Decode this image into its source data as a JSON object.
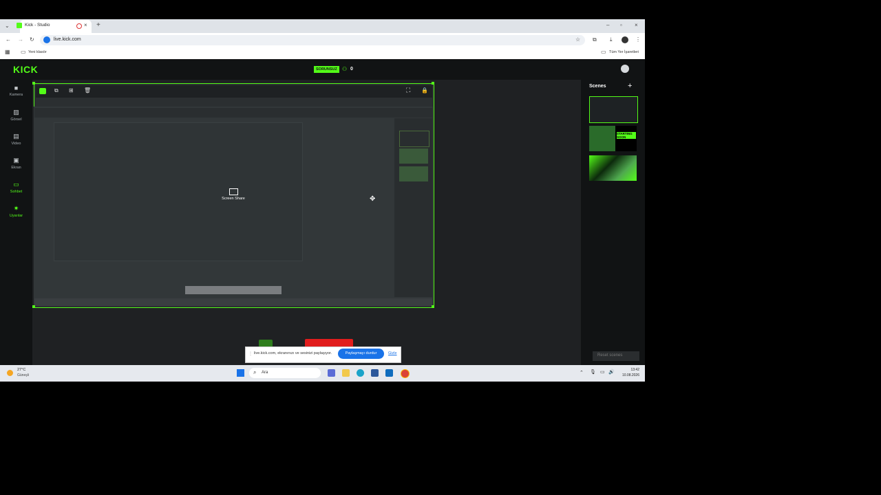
{
  "browser": {
    "tab_title": "Kick - Studio",
    "url": "live.kick.com",
    "bookmark_folder": "Yeni klasör",
    "all_bookmarks": "Tüm Yer İşaretleri"
  },
  "header": {
    "logo": "KICK",
    "status_badge": "SORUNSUZ",
    "viewer_count": "0"
  },
  "sidebar": {
    "items": [
      {
        "label": "Kamera",
        "icon": "camera-icon"
      },
      {
        "label": "Görsel",
        "icon": "image-icon"
      },
      {
        "label": "Video",
        "icon": "film-icon"
      },
      {
        "label": "Ekran",
        "icon": "screen-cast-icon"
      },
      {
        "label": "Sohbet",
        "icon": "chat-icon"
      },
      {
        "label": "Uyarılar",
        "icon": "alerts-icon"
      }
    ]
  },
  "canvas": {
    "source_label": "Screen Share"
  },
  "scenes": {
    "title": "Scenes",
    "reset_label": "Reset scenes",
    "thumb2_text": "STARTING SOON"
  },
  "share_bar": {
    "message": "live.kick.com, ekranınızı ve sesinizi paylaşıyor.",
    "stop_button": "Paylaşmayı durdur",
    "hide_link": "Gizle"
  },
  "taskbar": {
    "weather_temp": "27°C",
    "weather_desc": "Güneşli",
    "search_placeholder": "Ara",
    "time": "13:42",
    "date": "10.08.2026"
  },
  "colors": {
    "accent": "#53fc18",
    "stop_button": "#1a73e8",
    "record_red": "#e11d1d"
  }
}
